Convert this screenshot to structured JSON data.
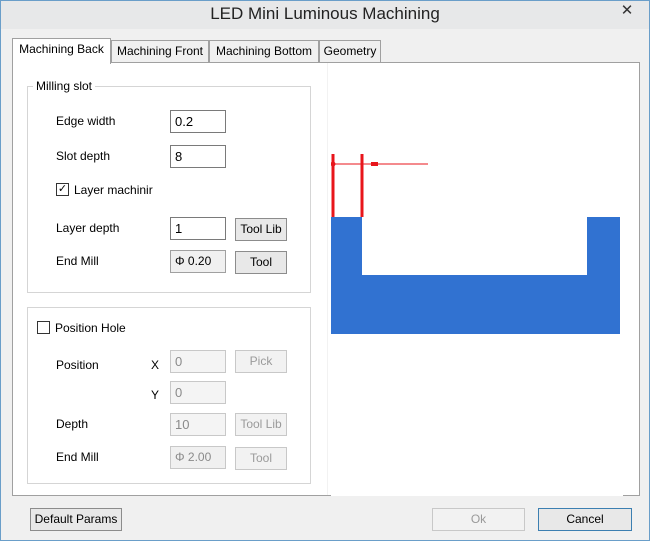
{
  "window": {
    "title": "LED Mini Luminous Machining",
    "close_glyph": "✕"
  },
  "tabs": [
    {
      "label": "Machining Back"
    },
    {
      "label": "Machining Front"
    },
    {
      "label": "Machining Bottom"
    },
    {
      "label": "Geometry"
    }
  ],
  "milling_slot": {
    "title": "Milling slot",
    "edge_width_label": "Edge width",
    "edge_width_value": "0.2",
    "slot_depth_label": "Slot depth",
    "slot_depth_value": "8",
    "layer_machining_label": "Layer machinir",
    "layer_machining_checked": true,
    "layer_depth_label": "Layer depth",
    "layer_depth_value": "1",
    "tool_lib_label": "Tool Lib",
    "end_mill_label": "End Mill",
    "end_mill_value": "Φ 0.20",
    "tool_label": "Tool"
  },
  "position_hole": {
    "title": "Position Hole",
    "checked": false,
    "position_label": "Position",
    "x_label": "X",
    "x_value": "0",
    "pick_label": "Pick",
    "y_label": "Y",
    "y_value": "0",
    "depth_label": "Depth",
    "depth_value": "10",
    "tool_lib_label": "Tool Lib",
    "end_mill_label": "End Mill",
    "end_mill_value": "Φ 2.00",
    "tool_label": "Tool"
  },
  "footer": {
    "default_params_label": "Default Params",
    "ok_label": "Ok",
    "cancel_label": "Cancel"
  },
  "colors": {
    "profile_fill": "#3172d1",
    "dimension_red": "#e8151b"
  }
}
